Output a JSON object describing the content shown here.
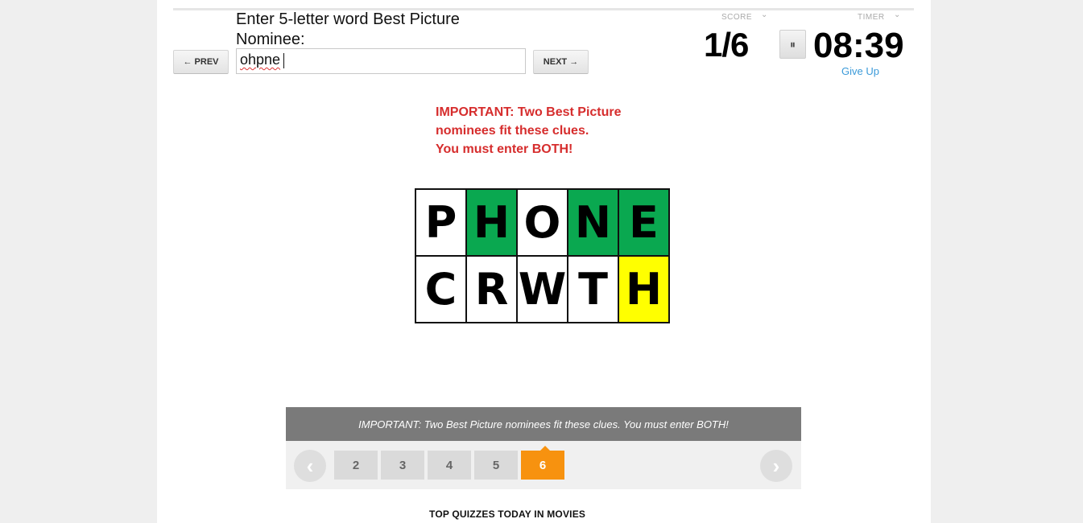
{
  "quiz": {
    "prompt": "Enter 5-letter word Best Picture Nominee:",
    "prev_label": "← PREV",
    "next_label": "NEXT →",
    "answer_value": "ohpne"
  },
  "scoreboard": {
    "score_label": "SCORE",
    "score_value": "1/6",
    "timer_label": "TIMER",
    "timer_value": "08:39",
    "pause_label": "⏸",
    "give_up_label": "Give Up"
  },
  "notice": {
    "line1": "IMPORTANT: Two Best Picture",
    "line2": "nominees fit these clues.",
    "line3": "You must enter BOTH!"
  },
  "grid": {
    "rows": [
      [
        {
          "letter": "P",
          "color": "#ffffff"
        },
        {
          "letter": "H",
          "color": "#0aa850"
        },
        {
          "letter": "O",
          "color": "#ffffff"
        },
        {
          "letter": "N",
          "color": "#0aa850"
        },
        {
          "letter": "E",
          "color": "#0aa850"
        }
      ],
      [
        {
          "letter": "C",
          "color": "#ffffff"
        },
        {
          "letter": "R",
          "color": "#ffffff"
        },
        {
          "letter": "W",
          "color": "#ffffff"
        },
        {
          "letter": "T",
          "color": "#ffffff"
        },
        {
          "letter": "H",
          "color": "#ffff00"
        }
      ]
    ]
  },
  "clue_bar": {
    "text": "IMPORTANT: Two Best Picture nominees fit these clues. You must enter BOTH!"
  },
  "pager": {
    "prev_icon": "chevron-left-icon",
    "next_icon": "chevron-right-icon",
    "pages": [
      "2",
      "3",
      "4",
      "5",
      "6"
    ],
    "active_page": "6"
  },
  "footer": {
    "top_quizzes": "TOP QUIZZES TODAY IN MOVIES"
  },
  "colors": {
    "accent_orange": "#f7920f",
    "correct_green": "#0aa850",
    "present_yellow": "#ffff00",
    "notice_red": "#d62d2d",
    "link_blue": "#3b9ad9"
  }
}
